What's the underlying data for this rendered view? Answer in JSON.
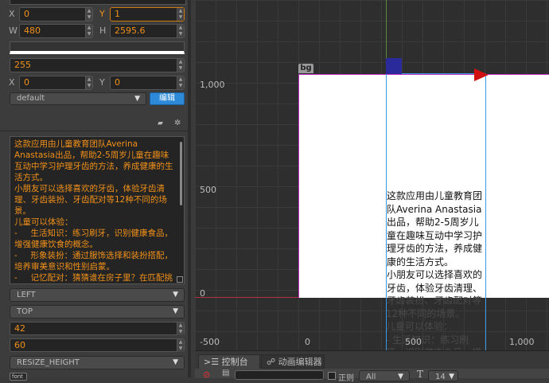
{
  "inspector": {
    "pos": {
      "x_label": "X",
      "x": "0",
      "y_label": "Y",
      "y": "1"
    },
    "size": {
      "w_label": "W",
      "w": "480",
      "h_label": "H",
      "h": "2595.6"
    },
    "opacity": "255",
    "anchor": {
      "x_label": "X",
      "x": "0",
      "y_label": "Y",
      "y": "0"
    },
    "material": "default",
    "edit_button": "编辑",
    "text": "这款应用由儿童教育团队Averina Anastasia出品，帮助2-5周岁儿童在趣味互动中学习护理牙齿的方法，养成健康的生活方式。\n小朋友可以选择喜欢的牙齿，体验牙齿清理、牙齿装扮、牙齿配对等12种不同的场景。\n儿童可以体验：\n-     生活知识：练习刷牙，识别健康食品，增强健康饮食的概念。\n-     形象装扮：通过服饰选择和装扮搭配，培养审美意识和性别启蒙。\n-     记忆配对：猜猜谁在房子里？在匹配挑战中提升记忆力和专注力。\n儿童可以获得：",
    "h_align": "LEFT",
    "v_align": "TOP",
    "font_size": "42",
    "line_height": "60",
    "overflow": "RESIZE_HEIGHT",
    "font_label": "font"
  },
  "scene": {
    "node_label": "bg",
    "y_ticks": [
      "1,000",
      "500",
      "0"
    ],
    "x_ticks": [
      "-500",
      "0",
      "500",
      "1,000"
    ],
    "scene_text": "这款应用由儿童教育团队Averina Anastasia出品，帮助2-5周岁儿童在趣味互动中学习护理牙齿的方法，养成健康的生活方式。\n小朋友可以选择喜欢的牙齿，体验牙齿清理、牙齿装扮、牙齿配对等12种不同的场景。\n儿童可以体验：\n- 生活知识：练习刷牙，识别健康食品，增强健康"
  },
  "bottom": {
    "tabs": [
      {
        "label": "控制台"
      },
      {
        "label": "动画编辑器"
      }
    ],
    "regex_label": "正则",
    "filter": "All",
    "font_size": "14"
  },
  "colors": {
    "accent": "#f0901a",
    "button": "#2d8ad8"
  }
}
